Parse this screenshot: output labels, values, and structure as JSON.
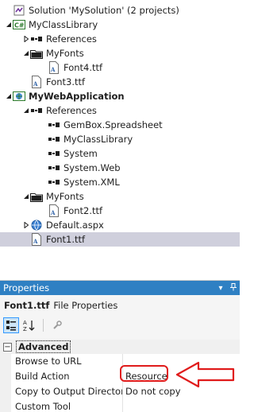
{
  "solution_explorer": {
    "items": [
      {
        "label": "Solution 'MySolution' (2 projects)",
        "icon": "solution-icon",
        "expander": "none",
        "bold": false
      },
      {
        "label": "MyClassLibrary",
        "icon": "csharp-project-icon",
        "expander": "expanded",
        "bold": false
      },
      {
        "label": "References",
        "icon": "references-icon",
        "expander": "collapsed",
        "bold": false
      },
      {
        "label": "MyFonts",
        "icon": "folder-icon",
        "expander": "expanded",
        "bold": false
      },
      {
        "label": "Font4.ttf",
        "icon": "font-file-icon",
        "expander": "none",
        "bold": false
      },
      {
        "label": "Font3.ttf",
        "icon": "font-file-icon",
        "expander": "none",
        "bold": false
      },
      {
        "label": "MyWebApplication",
        "icon": "web-project-icon",
        "expander": "expanded",
        "bold": true
      },
      {
        "label": "References",
        "icon": "references-icon",
        "expander": "expanded",
        "bold": false
      },
      {
        "label": "GemBox.Spreadsheet",
        "icon": "assembly-reference-icon",
        "expander": "none",
        "bold": false
      },
      {
        "label": "MyClassLibrary",
        "icon": "assembly-reference-icon",
        "expander": "none",
        "bold": false
      },
      {
        "label": "System",
        "icon": "assembly-reference-icon",
        "expander": "none",
        "bold": false
      },
      {
        "label": "System.Web",
        "icon": "assembly-reference-icon",
        "expander": "none",
        "bold": false
      },
      {
        "label": "System.XML",
        "icon": "assembly-reference-icon",
        "expander": "none",
        "bold": false
      },
      {
        "label": "MyFonts",
        "icon": "folder-icon",
        "expander": "expanded",
        "bold": false
      },
      {
        "label": "Font2.ttf",
        "icon": "font-file-icon",
        "expander": "none",
        "bold": false
      },
      {
        "label": "Default.aspx",
        "icon": "aspx-page-icon",
        "expander": "collapsed",
        "bold": false
      },
      {
        "label": "Font1.ttf",
        "icon": "font-file-icon",
        "expander": "none",
        "bold": false,
        "selected": true
      }
    ]
  },
  "properties": {
    "title": "Properties",
    "pin_glyph": "▾ ⊣",
    "object_name": "Font1.ttf",
    "object_type": "File Properties",
    "category": {
      "label": "Advanced",
      "toggle": "−"
    },
    "rows": [
      {
        "name": "Browse to URL",
        "value": ""
      },
      {
        "name": "Build Action",
        "value": "Resource"
      },
      {
        "name": "Copy to Output Directory",
        "value": "Do not copy"
      },
      {
        "name": "Custom Tool",
        "value": ""
      }
    ]
  },
  "colors": {
    "accent": "#2f80c3",
    "selection": "#cfcfdc",
    "callout": "#e01b1b"
  }
}
